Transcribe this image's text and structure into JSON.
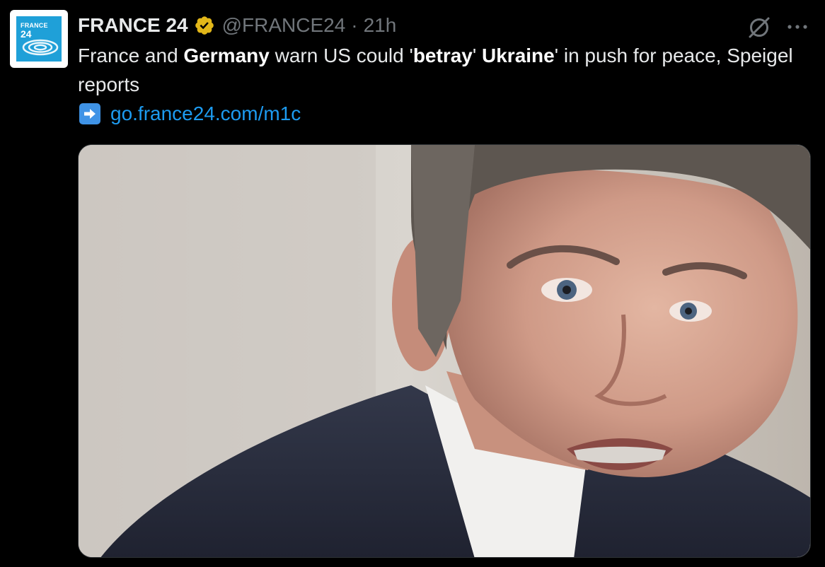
{
  "author": {
    "name": "FRANCE 24",
    "handle": "@FRANCE24",
    "separator": "·",
    "time": "21h",
    "avatar_text_top": "FRANCE",
    "avatar_text_bottom": "24",
    "avatar_color": "#1fa0d8",
    "verified_badge_color": "#e2b719"
  },
  "tweet": {
    "text_segments": [
      {
        "text": "France and ",
        "bold": false
      },
      {
        "text": "Germany",
        "bold": true
      },
      {
        "text": " warn US could '",
        "bold": false
      },
      {
        "text": "betray",
        "bold": true
      },
      {
        "text": "' ",
        "bold": false
      },
      {
        "text": "Ukraine",
        "bold": true
      },
      {
        "text": "' in push for peace, Speigel reports",
        "bold": false
      }
    ],
    "link_icon": "right-arrow-emoji",
    "link_text": "go.france24.com/m1c",
    "link_color": "#1d9bf0"
  },
  "icons": {
    "grok": "grok-icon",
    "more": "more-options-icon"
  },
  "media": {
    "description_icon": "photo-image"
  }
}
